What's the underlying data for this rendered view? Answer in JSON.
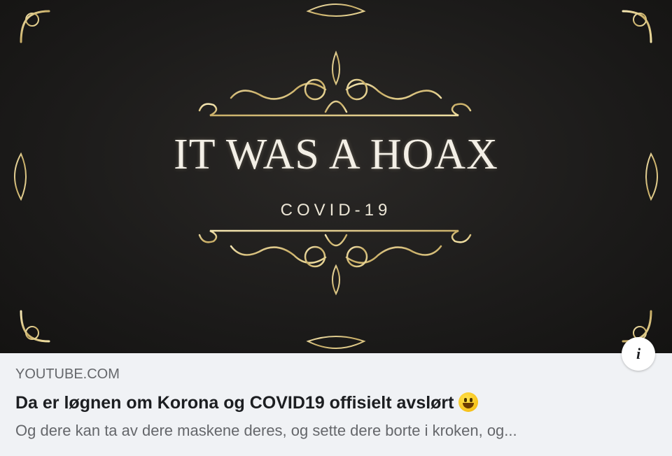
{
  "thumbnail": {
    "headline": "IT WAS A HOAX",
    "subheadline": "COVID-19",
    "frame_color": "#d8c48a"
  },
  "info_button": {
    "icon": "info-icon",
    "label": "i"
  },
  "link": {
    "domain": "YOUTUBE.COM",
    "title": "Da er løgnen om Korona og COVID19 offisielt avslørt",
    "title_emoji": "grinning-face-emoji",
    "description": "Og dere kan ta av dere maskene deres, og sette dere borte i kroken, og..."
  },
  "colors": {
    "card_background": "#f0f2f5",
    "secondary_text": "#65676b",
    "primary_text": "#1c1e21",
    "gold": "#d8c48a"
  }
}
